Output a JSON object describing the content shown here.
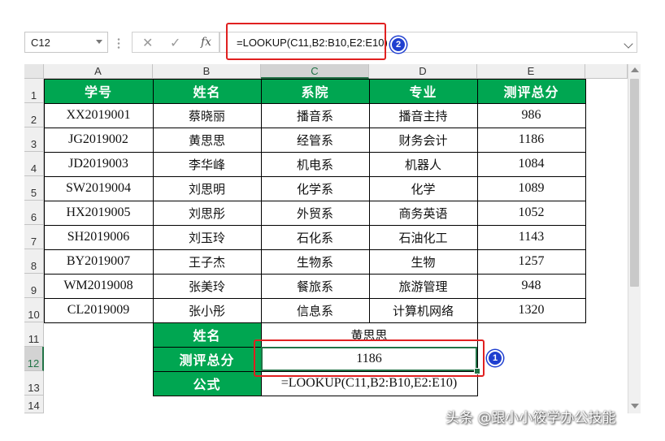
{
  "name_box": {
    "value": "C12"
  },
  "formula_bar": {
    "cancel_glyph": "✕",
    "enter_glyph": "✓",
    "fx_label": "fx",
    "formula": "=LOOKUP(C11,B2:B10,E2:E10)"
  },
  "badges": {
    "one": "1",
    "two": "2"
  },
  "columns": [
    "A",
    "B",
    "C",
    "D",
    "E"
  ],
  "rows": [
    "1",
    "2",
    "3",
    "4",
    "5",
    "6",
    "7",
    "8",
    "9",
    "10",
    "11",
    "12",
    "13",
    "14"
  ],
  "table": {
    "headers": [
      "学号",
      "姓名",
      "系院",
      "专业",
      "测评总分"
    ],
    "rows": [
      [
        "XX2019001",
        "蔡晓丽",
        "播音系",
        "播音主持",
        "986"
      ],
      [
        "JG2019002",
        "黄思思",
        "经管系",
        "财务会计",
        "1186"
      ],
      [
        "JD2019003",
        "李华峰",
        "机电系",
        "机器人",
        "1084"
      ],
      [
        "SW2019004",
        "刘思明",
        "化学系",
        "化学",
        "1089"
      ],
      [
        "HX2019005",
        "刘思彤",
        "外贸系",
        "商务英语",
        "1052"
      ],
      [
        "SH2019006",
        "刘玉玲",
        "石化系",
        "石油化工",
        "1143"
      ],
      [
        "BY2019007",
        "王子杰",
        "生物系",
        "生物",
        "1257"
      ],
      [
        "WM2019008",
        "张美玲",
        "餐旅系",
        "旅游管理",
        "948"
      ],
      [
        "CL2019009",
        "张小彤",
        "信息系",
        "计算机网络",
        "1320"
      ]
    ]
  },
  "lookup": {
    "name_label": "姓名",
    "name_value": "黄思思",
    "score_label": "测评总分",
    "score_value": "1186",
    "formula_label": "公式",
    "formula_value": "=LOOKUP(C11,B2:B10,E2:E10)"
  },
  "colors": {
    "header_green": "#00a651",
    "highlight_red": "#e02020",
    "badge_blue": "#1f3fd0"
  },
  "watermark": "头条 @跟小小筱学办公技能"
}
